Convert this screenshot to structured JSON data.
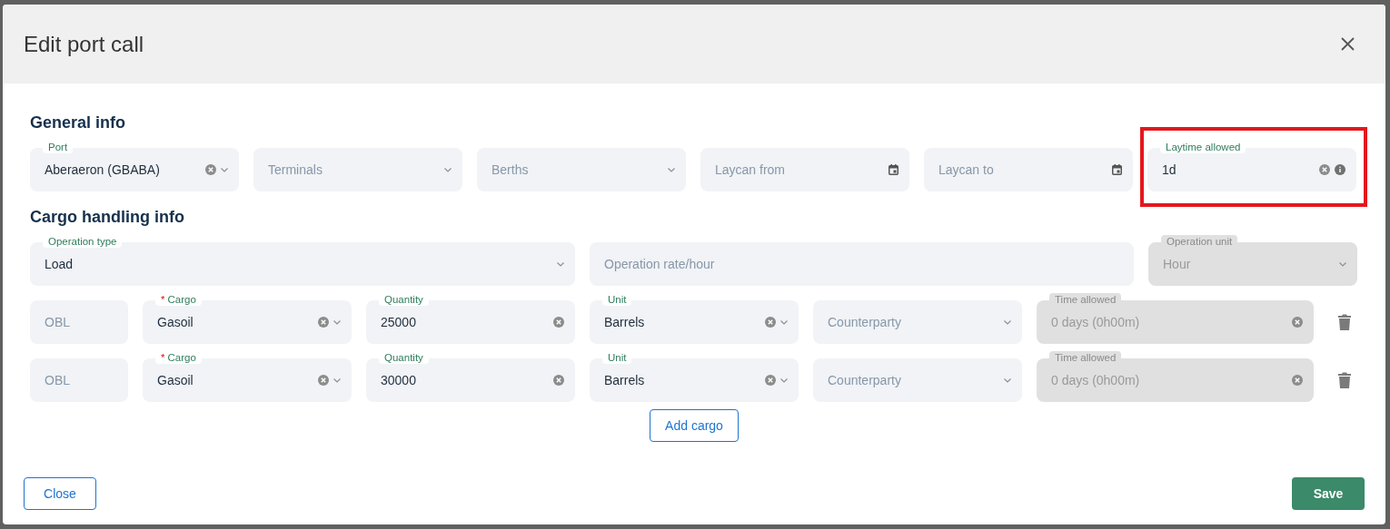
{
  "dialog": {
    "title": "Edit port call",
    "sections": [
      {
        "heading": "General info",
        "kind": "general",
        "fields": [
          {
            "kind": "select",
            "label": "Port",
            "value": "Aberaeron (GBABA)",
            "clearable": true,
            "disabled": false,
            "highlighted": false
          },
          {
            "kind": "select",
            "placeholder": "Terminals",
            "clearable": false,
            "disabled": false,
            "highlighted": false
          },
          {
            "kind": "select",
            "placeholder": "Berths",
            "clearable": false,
            "disabled": false,
            "highlighted": false
          },
          {
            "kind": "date",
            "placeholder": "Laycan from",
            "clearable": false,
            "disabled": false,
            "highlighted": false
          },
          {
            "kind": "date",
            "placeholder": "Laycan to",
            "clearable": false,
            "disabled": false,
            "highlighted": false
          },
          {
            "kind": "text",
            "label": "Laytime allowed",
            "value": "1d",
            "clearable": true,
            "info": true,
            "disabled": false,
            "highlighted": true
          }
        ]
      },
      {
        "heading": "Cargo handling info",
        "kind": "operation",
        "fields": [
          {
            "kind": "select",
            "label": "Operation type",
            "value": "Load",
            "clearable": false,
            "disabled": false,
            "highlighted": false
          },
          {
            "kind": "text",
            "placeholder": "Operation rate/hour",
            "clearable": false,
            "disabled": false,
            "highlighted": false
          },
          {
            "kind": "select",
            "label": "Operation unit",
            "value": "Hour",
            "clearable": false,
            "disabled": true,
            "highlighted": false
          }
        ]
      }
    ],
    "cargo_rows": [
      {
        "fields": [
          {
            "kind": "text",
            "placeholder": "OBL",
            "clearable": false,
            "disabled": false
          },
          {
            "kind": "select",
            "label": "Cargo",
            "required_mark": "*",
            "value": "Gasoil",
            "clearable": true,
            "disabled": false
          },
          {
            "kind": "text",
            "label": "Quantity",
            "value": "25000",
            "clearable": true,
            "disabled": false
          },
          {
            "kind": "select",
            "label": "Unit",
            "value": "Barrels",
            "clearable": true,
            "disabled": false
          },
          {
            "kind": "select",
            "placeholder": "Counterparty",
            "clearable": false,
            "disabled": false
          },
          {
            "kind": "text",
            "label": "Time allowed",
            "value": "0 days (0h00m)",
            "clearable": true,
            "disabled": true
          }
        ]
      },
      {
        "fields": [
          {
            "kind": "text",
            "placeholder": "OBL",
            "clearable": false,
            "disabled": false
          },
          {
            "kind": "select",
            "label": "Cargo",
            "required_mark": "*",
            "value": "Gasoil",
            "clearable": true,
            "disabled": false
          },
          {
            "kind": "text",
            "label": "Quantity",
            "value": "30000",
            "clearable": true,
            "disabled": false
          },
          {
            "kind": "select",
            "label": "Unit",
            "value": "Barrels",
            "clearable": true,
            "disabled": false
          },
          {
            "kind": "select",
            "placeholder": "Counterparty",
            "clearable": false,
            "disabled": false
          },
          {
            "kind": "text",
            "label": "Time allowed",
            "value": "0 days (0h00m)",
            "clearable": true,
            "disabled": true
          }
        ]
      }
    ],
    "add_button": "Add cargo",
    "close_button": "Close",
    "save_button": "Save"
  }
}
